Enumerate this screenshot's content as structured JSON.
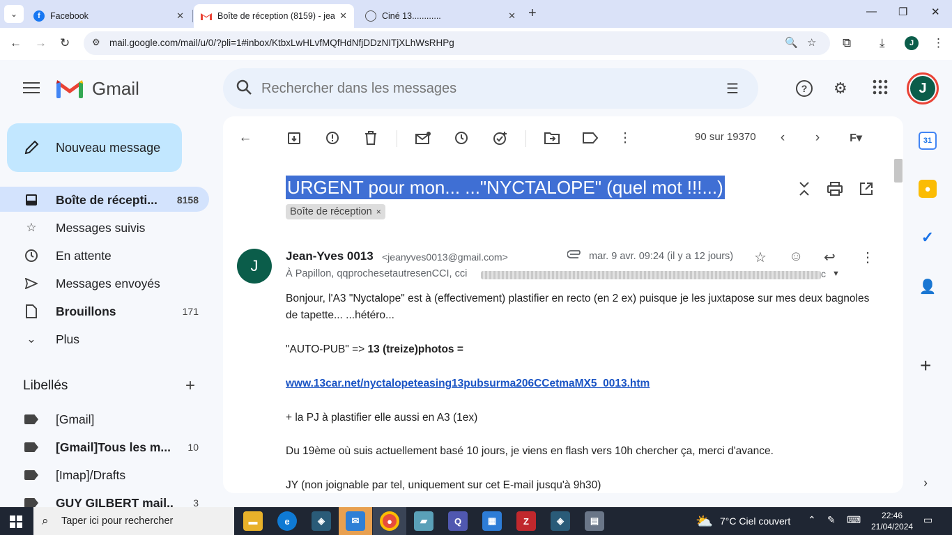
{
  "browser": {
    "tabs": [
      {
        "title": "Facebook",
        "close": "✕"
      },
      {
        "title": "Boîte de réception (8159) - jea",
        "close": "✕"
      },
      {
        "title": "Ciné 13............",
        "close": "✕"
      }
    ],
    "url": "mail.google.com/mail/u/0/?pli=1#inbox/KtbxLwHLvfMQfHdNfjDDzNITjXLhWsRHPg",
    "profile_initial": "J"
  },
  "gmail": {
    "brand": "Gmail",
    "search_placeholder": "Rechercher dans les messages",
    "avatar_initial": "J",
    "compose_label": "Nouveau message",
    "nav": [
      {
        "label": "Boîte de récepti...",
        "count": "8158",
        "icon": "inbox-icon"
      },
      {
        "label": "Messages suivis",
        "count": "",
        "icon": "star-icon"
      },
      {
        "label": "En attente",
        "count": "",
        "icon": "clock-icon"
      },
      {
        "label": "Messages envoyés",
        "count": "",
        "icon": "send-icon"
      },
      {
        "label": "Brouillons",
        "count": "171",
        "icon": "draft-icon"
      },
      {
        "label": "Plus",
        "count": "",
        "icon": "chevron-down-icon"
      }
    ],
    "labels_title": "Libellés",
    "labels": [
      {
        "label": "[Gmail]",
        "count": ""
      },
      {
        "label": "[Gmail]Tous les m...",
        "count": "10"
      },
      {
        "label": "[Imap]/Drafts",
        "count": ""
      },
      {
        "label": "GUY GILBERT mail...",
        "count": "3"
      }
    ]
  },
  "message": {
    "pager": "90 sur 19370",
    "subject": "URGENT pour mon... ...\"NYCTALOPE\" (quel mot !!!...)",
    "chip": "Boîte de réception",
    "chip_close": "×",
    "sender_initial": "J",
    "sender_name": "Jean-Yves 0013",
    "sender_email": "<jeanyves0013@gmail.com>",
    "date": "mar. 9 avr. 09:24 (il y a 12 jours)",
    "recipients": "À Papillon, qqprochesetautresenCCI, cci",
    "recipients_tail": "c",
    "body": {
      "p1": "Bonjour, l'A3 \"Nyctalope\"  est à (effectivement) plastifier en recto (en 2 ex)  puisque je les juxtapose sur mes deux bagnoles de tapette... ...hétéro...",
      "p2_prefix": "\"AUTO-PUB\" => ",
      "p2_bold": "13 (treize)photos =",
      "link": "www.13car.net/nyctalopeteasing13pubsurma206CCetmaMX5_0013.htm",
      "p3": "+ la PJ à plastifier elle aussi en A3 (1ex)",
      "p4": "Du 19ème où suis actuellement basé 10 jours, je viens en flash vers 10h chercher ça, merci d'avance.",
      "p5": "JY (non joignable par tel, uniquement sur cet E-mail jusqu'à 9h30)"
    }
  },
  "sidepanel": {
    "calendar_day": "31"
  },
  "taskbar": {
    "search_placeholder": "Taper ici pour rechercher",
    "weather": "7°C  Ciel couvert",
    "time": "22:46",
    "date": "21/04/2024"
  },
  "colors": {
    "gmail_bg": "#f6f8fc",
    "selected_nav": "#d3e3fd",
    "compose": "#c2e7ff",
    "subject_highlight": "#3f6fd4",
    "avatar": "#0b5d4a"
  }
}
